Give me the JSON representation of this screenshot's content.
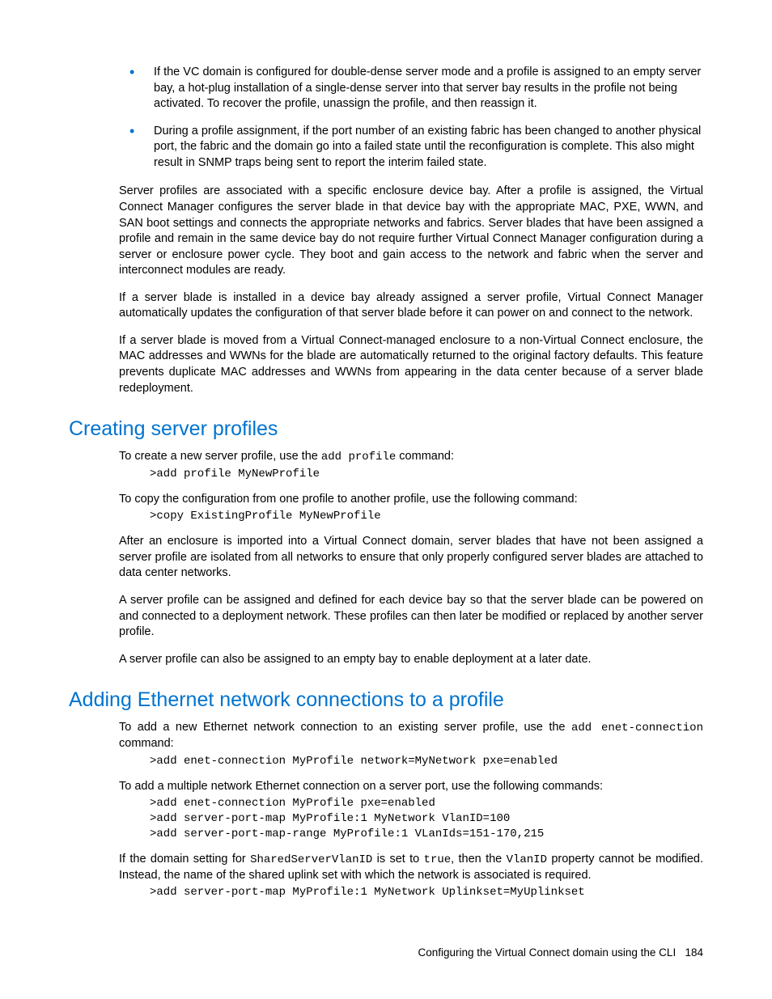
{
  "bullets": [
    "If the VC domain is configured for double-dense server mode and a profile is assigned to an empty server bay, a hot-plug installation of a single-dense server into that server bay results in the profile not being activated. To recover the profile, unassign the profile, and then reassign it.",
    "During a profile assignment, if the port number of an existing fabric has been changed to another physical port, the fabric and the domain go into a failed state until the reconfiguration is complete. This also might result in SNMP traps being sent to report the interim failed state."
  ],
  "intro_paras": [
    "Server profiles are associated with a specific enclosure device bay. After a profile is assigned, the Virtual Connect Manager configures the server blade in that device bay with the appropriate MAC, PXE, WWN, and SAN boot settings and connects the appropriate networks and fabrics. Server blades that have been assigned a profile and remain in the same device bay do not require further Virtual Connect Manager configuration during a server or enclosure power cycle. They boot and gain access to the network and fabric when the server and interconnect modules are ready.",
    "If a server blade is installed in a device bay already assigned a server profile, Virtual Connect Manager automatically updates the configuration of that server blade before it can power on and connect to the network.",
    "If a server blade is moved from a Virtual Connect-managed enclosure to a non-Virtual Connect enclosure, the MAC addresses and WWNs for the blade are automatically returned to the original factory defaults. This feature prevents duplicate MAC addresses and WWNs from appearing in the data center because of a server blade redeployment."
  ],
  "section1": {
    "title": "Creating server profiles",
    "p1a": "To create a new server profile, use the ",
    "p1code": "add profile",
    "p1b": " command:",
    "cmd1": ">add profile MyNewProfile",
    "p2": "To copy the configuration from one profile to another profile, use the following command:",
    "cmd2": ">copy ExistingProfile MyNewProfile",
    "p3": "After an enclosure is imported into a Virtual Connect domain, server blades that have not been assigned a server profile are isolated from all networks to ensure that only properly configured server blades are attached to data center networks.",
    "p4": "A server profile can be assigned and defined for each device bay so that the server blade can be powered on and connected to a deployment network. These profiles can then later be modified or replaced by another server profile.",
    "p5": "A server profile can also be assigned to an empty bay to enable deployment at a later date."
  },
  "section2": {
    "title": "Adding Ethernet network connections to a profile",
    "p1a": "To add a new Ethernet network connection to an existing server profile, use the ",
    "p1code": "add enet-connection",
    "p1b": " command:",
    "cmd1": ">add enet-connection MyProfile network=MyNetwork pxe=enabled",
    "p2": "To add a multiple network Ethernet connection on a server port, use the following commands:",
    "cmd2": ">add enet-connection MyProfile pxe=enabled\n>add server-port-map MyProfile:1 MyNetwork VlanID=100\n>add server-port-map-range MyProfile:1 VLanIds=151-170,215",
    "p3a": "If the domain setting for ",
    "p3code1": "SharedServerVlanID",
    "p3b": " is set to ",
    "p3code2": "true",
    "p3c": ", then the ",
    "p3code3": "VlanID",
    "p3d": " property cannot be modified. Instead, the name of the shared uplink set with which the network is associated is required.",
    "cmd3": ">add server-port-map MyProfile:1 MyNetwork Uplinkset=MyUplinkset"
  },
  "footer": {
    "text": "Configuring the Virtual Connect domain using the CLI",
    "page": "184"
  }
}
